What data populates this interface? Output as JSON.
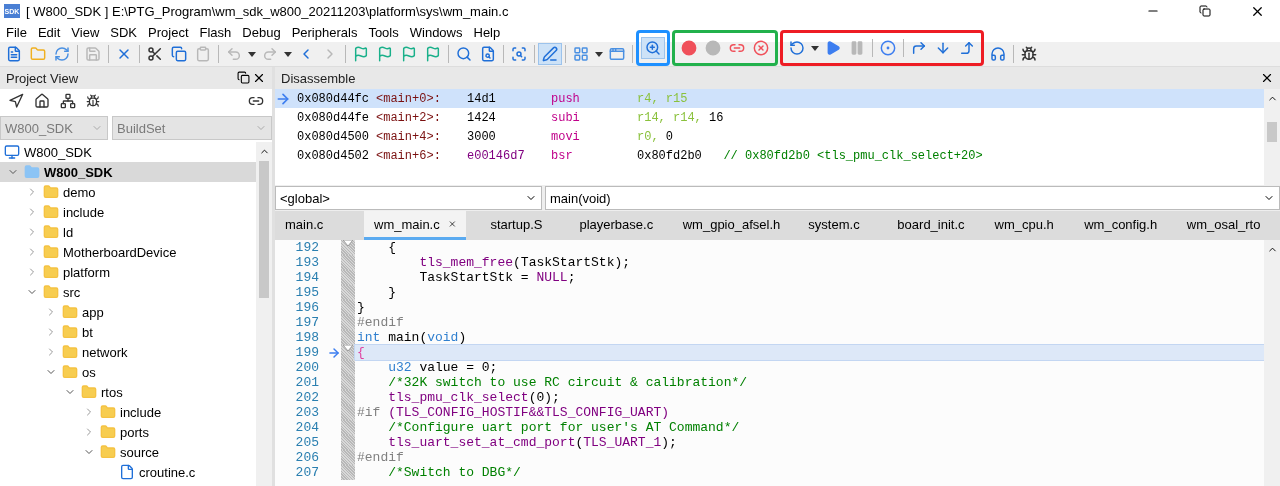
{
  "window": {
    "icon_text": "SDK",
    "title": "[ W800_SDK ] E:\\PTG_Program\\wm_sdk_w800_20211203\\platform\\sys\\wm_main.c"
  },
  "menu": [
    "File",
    "Edit",
    "View",
    "SDK",
    "Project",
    "Flash",
    "Debug",
    "Peripherals",
    "Tools",
    "Windows",
    "Help"
  ],
  "toolbar": [
    {
      "items": [
        {
          "kind": "button",
          "disabled": false,
          "pressed": false
        },
        {
          "kind": "button",
          "disabled": false,
          "pressed": false
        },
        {
          "kind": "button",
          "disabled": false,
          "pressed": false
        },
        {
          "kind": "separator"
        },
        {
          "kind": "button",
          "disabled": true,
          "pressed": false
        },
        {
          "kind": "separator"
        },
        {
          "kind": "button",
          "disabled": false,
          "pressed": false
        },
        {
          "kind": "separator"
        },
        {
          "kind": "button",
          "disabled": false,
          "pressed": false
        },
        {
          "kind": "button",
          "disabled": false,
          "pressed": false
        },
        {
          "kind": "button",
          "disabled": true,
          "pressed": false
        },
        {
          "kind": "separator"
        },
        {
          "kind": "button",
          "disabled": true,
          "pressed": false
        },
        {
          "kind": "caret"
        },
        {
          "kind": "button",
          "disabled": true,
          "pressed": false
        },
        {
          "kind": "caret"
        },
        {
          "kind": "button",
          "disabled": false,
          "pressed": false
        },
        {
          "kind": "button",
          "disabled": true,
          "pressed": false
        },
        {
          "kind": "separator"
        },
        {
          "kind": "button",
          "disabled": false,
          "pressed": false
        },
        {
          "kind": "button",
          "disabled": false,
          "pressed": false
        },
        {
          "kind": "button",
          "disabled": false,
          "pressed": false
        },
        {
          "kind": "button",
          "disabled": false,
          "pressed": false
        },
        {
          "kind": "separator"
        },
        {
          "kind": "button",
          "disabled": false,
          "pressed": false
        },
        {
          "kind": "button",
          "disabled": false,
          "pressed": false
        },
        {
          "kind": "separator"
        },
        {
          "kind": "button",
          "disabled": false,
          "pressed": false
        },
        {
          "kind": "separator"
        },
        {
          "kind": "button",
          "disabled": false,
          "pressed": true
        },
        {
          "kind": "separator"
        },
        {
          "kind": "button",
          "disabled": false,
          "pressed": false
        },
        {
          "kind": "caret"
        },
        {
          "kind": "button",
          "disabled": false,
          "pressed": false
        },
        {
          "kind": "separator"
        }
      ]
    },
    {
      "framed": true,
      "items": [
        {
          "kind": "button",
          "disabled": false,
          "pressed": true
        }
      ]
    },
    {
      "framed": true,
      "items": [
        {
          "kind": "button",
          "disabled": false,
          "pressed": false
        },
        {
          "kind": "button",
          "disabled": true,
          "pressed": false
        },
        {
          "kind": "button",
          "disabled": false,
          "pressed": false
        },
        {
          "kind": "button",
          "disabled": false,
          "pressed": false
        }
      ]
    },
    {
      "framed": true,
      "items": [
        {
          "kind": "button",
          "disabled": false,
          "pressed": false
        },
        {
          "kind": "caret"
        },
        {
          "kind": "button",
          "disabled": false,
          "pressed": false
        },
        {
          "kind": "button",
          "disabled": true,
          "pressed": false
        },
        {
          "kind": "separator"
        },
        {
          "kind": "button",
          "disabled": false,
          "pressed": false
        },
        {
          "kind": "separator"
        },
        {
          "kind": "button",
          "disabled": false,
          "pressed": false
        },
        {
          "kind": "button",
          "disabled": false,
          "pressed": false
        },
        {
          "kind": "button",
          "disabled": false,
          "pressed": false
        }
      ]
    },
    {
      "items": [
        {
          "kind": "button",
          "disabled": false,
          "pressed": false
        },
        {
          "kind": "separator"
        },
        {
          "kind": "button",
          "disabled": false,
          "pressed": false
        }
      ]
    }
  ],
  "project_view": {
    "title": "Project View",
    "selectors": [
      {
        "value": "W800_SDK",
        "disabled": true
      },
      {
        "value": "BuildSet",
        "disabled": true
      }
    ],
    "tree": [
      {
        "label": "W800_SDK",
        "kind": "workspace",
        "selected": false,
        "children": [
          {
            "label": "W800_SDK",
            "kind": "project",
            "expanded": true,
            "selected": true,
            "children": [
              {
                "label": "demo",
                "kind": "folder",
                "expanded": false,
                "selected": false
              },
              {
                "label": "include",
                "kind": "folder",
                "expanded": false,
                "selected": false
              },
              {
                "label": "ld",
                "kind": "folder",
                "expanded": false,
                "selected": false
              },
              {
                "label": "MotherboardDevice",
                "kind": "folder",
                "expanded": false,
                "selected": false
              },
              {
                "label": "platform",
                "kind": "folder",
                "expanded": false,
                "selected": false
              },
              {
                "label": "src",
                "kind": "folder",
                "expanded": true,
                "selected": false,
                "children": [
                  {
                    "label": "app",
                    "kind": "folder",
                    "expanded": false,
                    "selected": false
                  },
                  {
                    "label": "bt",
                    "kind": "folder",
                    "expanded": false,
                    "selected": false
                  },
                  {
                    "label": "network",
                    "kind": "folder",
                    "expanded": false,
                    "selected": false
                  },
                  {
                    "label": "os",
                    "kind": "folder",
                    "expanded": true,
                    "selected": false,
                    "children": [
                      {
                        "label": "rtos",
                        "kind": "folder",
                        "expanded": true,
                        "selected": false,
                        "children": [
                          {
                            "label": "include",
                            "kind": "folder",
                            "expanded": false,
                            "selected": false
                          },
                          {
                            "label": "ports",
                            "kind": "folder",
                            "expanded": false,
                            "selected": false
                          },
                          {
                            "label": "source",
                            "kind": "folder",
                            "expanded": true,
                            "selected": false,
                            "children": [
                              {
                                "label": "croutine.c",
                                "kind": "file",
                                "selected": false
                              }
                            ]
                          }
                        ]
                      }
                    ]
                  }
                ]
              }
            ]
          }
        ]
      }
    ]
  },
  "disassemble": {
    "title": "Disassemble",
    "rows": [
      {
        "current": true,
        "address": "0x080d44fc",
        "symbol": "<main+0>:",
        "opcode": {
          "text": "14d1",
          "kind": "plain"
        },
        "mnemonic": "push",
        "operands": [
          {
            "text": "r4, r15",
            "kind": "register"
          }
        ]
      },
      {
        "current": false,
        "address": "0x080d44fe",
        "symbol": "<main+2>:",
        "opcode": {
          "text": "1424",
          "kind": "plain"
        },
        "mnemonic": "subi",
        "operands": [
          {
            "text": "r14, r14,",
            "kind": "register"
          },
          {
            "text": " 16",
            "kind": "plain"
          }
        ]
      },
      {
        "current": false,
        "address": "0x080d4500",
        "symbol": "<main+4>:",
        "opcode": {
          "text": "3000",
          "kind": "plain"
        },
        "mnemonic": "movi",
        "operands": [
          {
            "text": "r0,",
            "kind": "register"
          },
          {
            "text": " 0",
            "kind": "plain"
          }
        ]
      },
      {
        "current": false,
        "address": "0x080d4502",
        "symbol": "<main+6>:",
        "opcode": {
          "text": "e00146d7",
          "kind": "branch"
        },
        "mnemonic": "bsr",
        "operands": [
          {
            "text": "0x80fd2b0",
            "kind": "plain"
          },
          {
            "text": "   // 0x80fd2b0 <tls_pmu_clk_select+20>",
            "kind": "comment"
          }
        ]
      }
    ]
  },
  "scope": {
    "left": "<global>",
    "right": "main(void)"
  },
  "tabs": [
    {
      "label": "main.c",
      "selected": false
    },
    {
      "label": "wm_main.c",
      "selected": true
    },
    {
      "label": "startup.S",
      "selected": false
    },
    {
      "label": "playerbase.c",
      "selected": false
    },
    {
      "label": "wm_gpio_afsel.h",
      "selected": false
    },
    {
      "label": "system.c",
      "selected": false
    },
    {
      "label": "board_init.c",
      "selected": false
    },
    {
      "label": "wm_cpu.h",
      "selected": false
    },
    {
      "label": "wm_config.h",
      "selected": false
    },
    {
      "label": "wm_osal_rto",
      "selected": false
    }
  ],
  "code": [
    {
      "number": "192",
      "fold": true,
      "current": false,
      "tokens": [
        {
          "text": "    {",
          "kind": "plain"
        }
      ]
    },
    {
      "number": "193",
      "fold": false,
      "current": false,
      "tokens": [
        {
          "text": "        tls_mem_free",
          "kind": "func"
        },
        {
          "text": "(TaskStartStk);",
          "kind": "plain"
        }
      ]
    },
    {
      "number": "194",
      "fold": false,
      "current": false,
      "tokens": [
        {
          "text": "        TaskStartStk = ",
          "kind": "plain"
        },
        {
          "text": "NULL",
          "kind": "macro"
        },
        {
          "text": ";",
          "kind": "plain"
        }
      ]
    },
    {
      "number": "195",
      "fold": false,
      "current": false,
      "tokens": [
        {
          "text": "    }",
          "kind": "plain"
        }
      ]
    },
    {
      "number": "196",
      "fold": false,
      "current": false,
      "tokens": [
        {
          "text": "}",
          "kind": "plain"
        }
      ]
    },
    {
      "number": "197",
      "fold": false,
      "current": false,
      "tokens": [
        {
          "text": "#endif",
          "kind": "preproc"
        }
      ]
    },
    {
      "number": "198",
      "fold": false,
      "current": false,
      "tokens": [
        {
          "text": "int",
          "kind": "keyword"
        },
        {
          "text": " main(",
          "kind": "plain"
        },
        {
          "text": "void",
          "kind": "keyword"
        },
        {
          "text": ")",
          "kind": "plain"
        }
      ]
    },
    {
      "number": "199",
      "fold": true,
      "current": true,
      "tokens": [
        {
          "text": "{",
          "kind": "brace"
        }
      ]
    },
    {
      "number": "200",
      "fold": false,
      "current": false,
      "tokens": [
        {
          "text": "    u32",
          "kind": "keyword"
        },
        {
          "text": " value = 0;",
          "kind": "plain"
        }
      ]
    },
    {
      "number": "201",
      "fold": false,
      "current": false,
      "tokens": [
        {
          "text": "    /*32K switch to use RC circuit & calibration*/",
          "kind": "comment"
        }
      ]
    },
    {
      "number": "202",
      "fold": false,
      "current": false,
      "tokens": [
        {
          "text": "    tls_pmu_clk_select",
          "kind": "func"
        },
        {
          "text": "(0);",
          "kind": "plain"
        }
      ]
    },
    {
      "number": "203",
      "fold": false,
      "current": false,
      "tokens": [
        {
          "text": "#if ",
          "kind": "preproc"
        },
        {
          "text": "(TLS_CONFIG_HOSTIF&&TLS_CONFIG_UART)",
          "kind": "macro"
        }
      ]
    },
    {
      "number": "204",
      "fold": false,
      "current": false,
      "tokens": [
        {
          "text": "    /*Configure uart port for user's AT Command*/",
          "kind": "comment"
        }
      ]
    },
    {
      "number": "205",
      "fold": false,
      "current": false,
      "tokens": [
        {
          "text": "    tls_uart_set_at_cmd_port",
          "kind": "func"
        },
        {
          "text": "(",
          "kind": "plain"
        },
        {
          "text": "TLS_UART_1",
          "kind": "macro"
        },
        {
          "text": ");",
          "kind": "plain"
        }
      ]
    },
    {
      "number": "206",
      "fold": false,
      "current": false,
      "tokens": [
        {
          "text": "#endif",
          "kind": "preproc"
        }
      ]
    },
    {
      "number": "207",
      "fold": false,
      "current": false,
      "tokens": [
        {
          "text": "    /*Switch to DBG*/",
          "kind": "comment"
        }
      ]
    }
  ]
}
